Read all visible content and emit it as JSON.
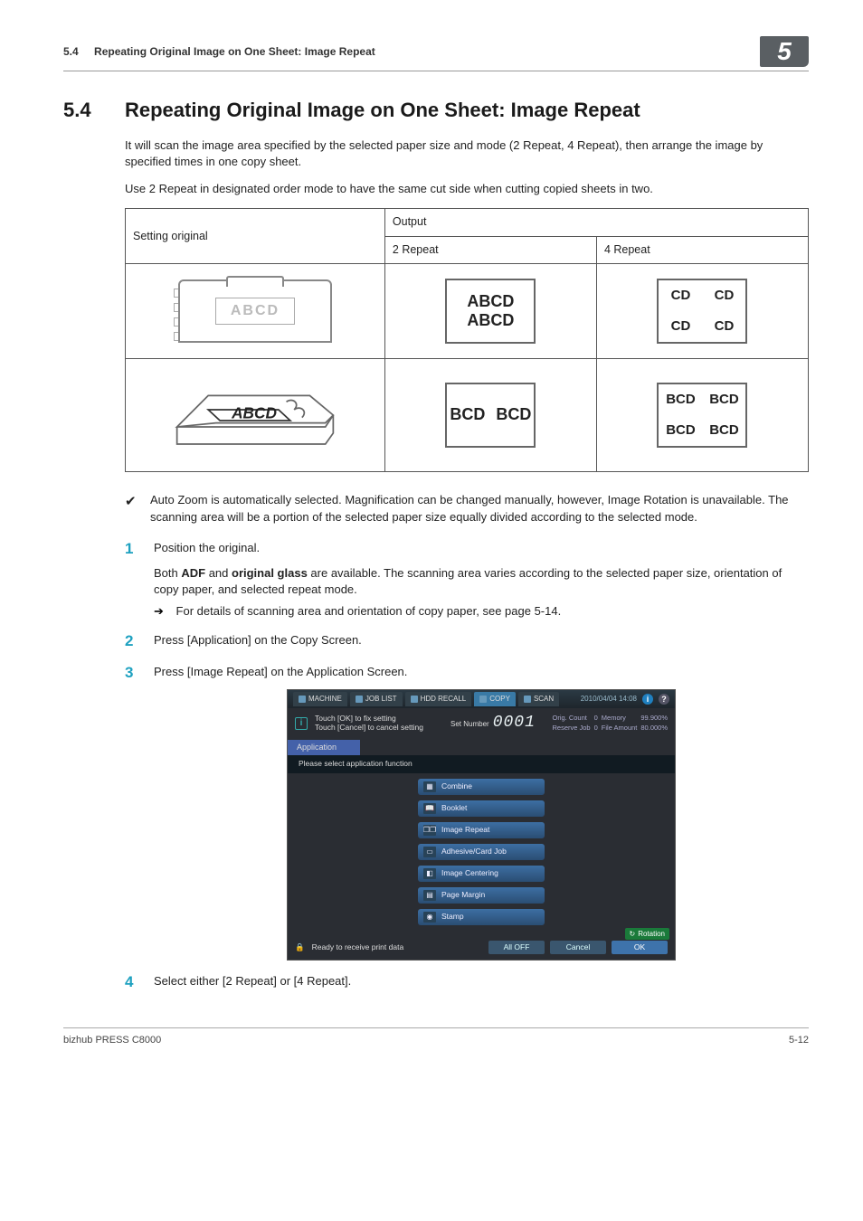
{
  "header": {
    "section_number": "5.4",
    "section_title": "Repeating Original Image on One Sheet: Image Repeat",
    "chapter_badge": "5"
  },
  "title": {
    "number": "5.4",
    "text": "Repeating Original Image on One Sheet: Image Repeat"
  },
  "intro_p1": "It will scan the image area specified by the selected paper size and mode (2 Repeat, 4 Repeat), then arrange the image by specified times in one copy sheet.",
  "intro_p2": "Use 2 Repeat in designated order mode to have the same cut side when cutting copied sheets in two.",
  "table": {
    "head_setting": "Setting original",
    "head_output": "Output",
    "head_2repeat": "2 Repeat",
    "head_4repeat": "4 Repeat",
    "adf_text": "ABCD",
    "glass_text": "ABCD",
    "out_adf_2_line1": "ABCD",
    "out_adf_2_line2": "ABCD",
    "out_adf_4_cell": "CD",
    "out_glass_2_half": "BCD",
    "out_glass_4_cell": "BCD"
  },
  "check_note": "Auto Zoom is automatically selected. Magnification can be changed manually, however, Image Rotation is unavailable. The scanning area will be a portion of the selected paper size equally divided according to the selected mode.",
  "steps": {
    "s1_text": "Position the original.",
    "s1_sub_a": "Both ",
    "s1_sub_b": "ADF",
    "s1_sub_c": " and ",
    "s1_sub_d": "original glass",
    "s1_sub_e": " are available. The scanning area varies according to the selected paper size, orientation of copy paper, and selected repeat mode.",
    "s1_arrow": "For details of scanning area and orientation of copy paper, see page 5-14.",
    "s2_text": "Press [Application] on the Copy Screen.",
    "s3_text": "Press [Image Repeat] on the Application Screen.",
    "s4_text": "Select either [2 Repeat] or [4 Repeat]."
  },
  "screenshot": {
    "tabs": {
      "machine": "MACHINE",
      "joblist": "JOB LIST",
      "hddrecall": "HDD RECALL",
      "copy": "COPY",
      "scan": "SCAN"
    },
    "date": "2010/04/04 14:08",
    "info_indicator": "i",
    "msg_l1": "Touch [OK] to fix setting",
    "msg_l2": "Touch [Cancel] to cancel setting",
    "setnum_label": "Set Number",
    "setnum_value": "0001",
    "stats": {
      "orig_label": "Orig. Count",
      "orig_val": "0",
      "reserve_label": "Reserve Job",
      "reserve_val": "0",
      "mem_label": "Memory",
      "mem_val": "99.900%",
      "file_label": "File Amount",
      "file_val": "80.000%"
    },
    "apptab": "Application",
    "subline": "Please select application function",
    "buttons": {
      "combine": "Combine",
      "booklet": "Booklet",
      "image_repeat": "Image Repeat",
      "adhesive": "Adhesive/Card Job",
      "centering": "Image Centering",
      "margin": "Page Margin",
      "stamp": "Stamp"
    },
    "rotflag": "Rotation",
    "bottom": {
      "ready": "Ready to receive print data",
      "alloff": "All OFF",
      "cancel": "Cancel",
      "ok": "OK"
    }
  },
  "footer": {
    "left": "bizhub PRESS C8000",
    "right": "5-12"
  }
}
